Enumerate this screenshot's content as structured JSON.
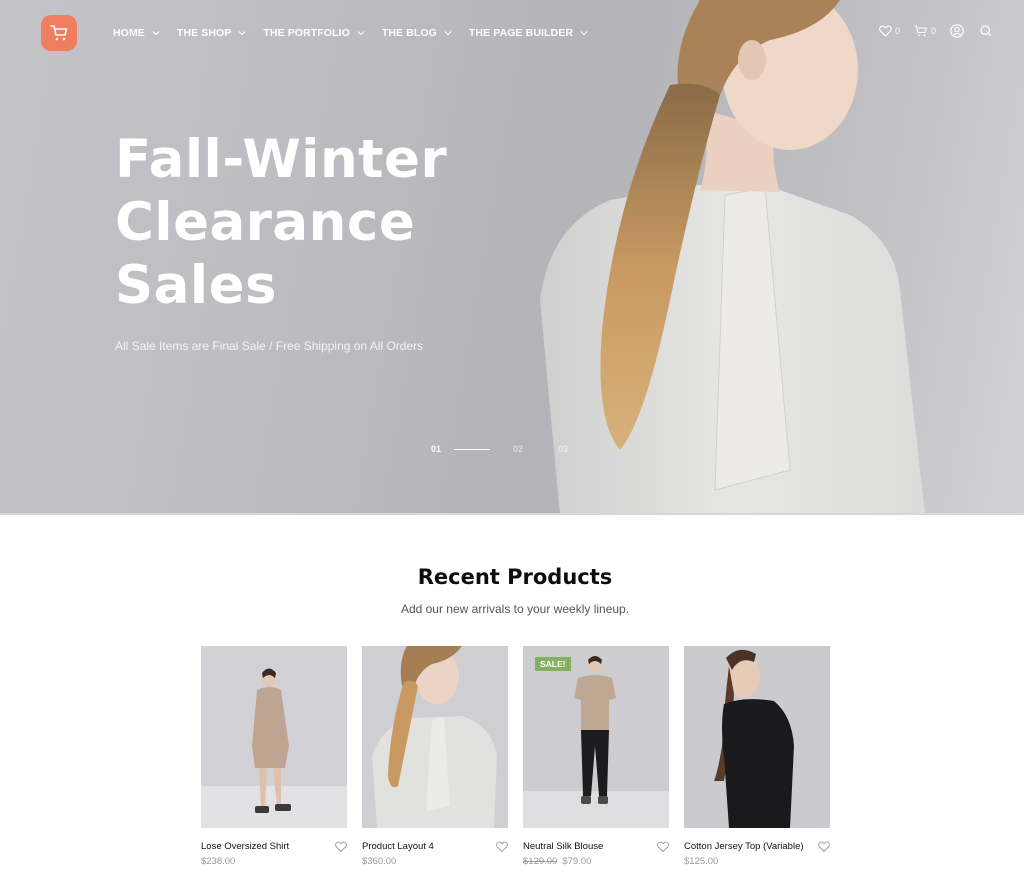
{
  "header": {
    "logo_icon": "shopping-cart-icon",
    "nav": [
      {
        "label": "HOME"
      },
      {
        "label": "THE SHOP"
      },
      {
        "label": "THE PORTFOLIO"
      },
      {
        "label": "THE BLOG"
      },
      {
        "label": "THE PAGE BUILDER"
      }
    ],
    "wishlist_count": "0",
    "cart_count": "0",
    "actions": [
      "heart-icon",
      "cart-icon",
      "user-icon",
      "search-icon"
    ]
  },
  "hero": {
    "title_lines": [
      "Fall-Winter",
      "Clearance",
      "Sales"
    ],
    "subtitle": "All Sale Items are Final Sale / Free Shipping on All Orders",
    "slides": [
      "01",
      "02",
      "03"
    ],
    "active_slide": "01"
  },
  "recent": {
    "title": "Recent Products",
    "subtitle": "Add our new arrivals to your weekly lineup.",
    "products": [
      {
        "name": "Lose Oversized Shirt",
        "price": "$238.00",
        "old_price": null,
        "sale": false
      },
      {
        "name": "Product Layout 4",
        "price": "$360.00",
        "old_price": null,
        "sale": false
      },
      {
        "name": "Neutral Silk Blouse",
        "price": "$79.00",
        "old_price": "$129.00",
        "sale": true,
        "badge": "SALE!"
      },
      {
        "name": "Cotton Jersey Top (Variable)",
        "price": "$125.00",
        "old_price": null,
        "sale": false
      }
    ]
  },
  "colors": {
    "brand": "#ef7d5f",
    "sale_badge": "#86b061",
    "price": "#9a9a9a"
  }
}
